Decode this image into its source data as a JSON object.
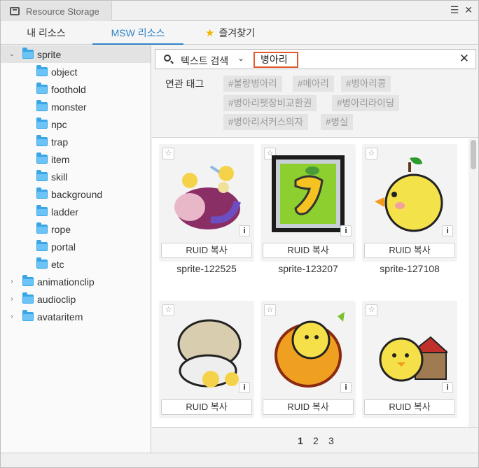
{
  "window": {
    "title": "Resource Storage",
    "menu_icon": "hamburger-icon",
    "close_icon": "close-icon"
  },
  "tabs": [
    {
      "label": "내 리소스"
    },
    {
      "label": "MSW 리소스"
    },
    {
      "label": "즐겨찾기"
    }
  ],
  "tree": {
    "root": "sprite",
    "children": [
      "object",
      "foothold",
      "monster",
      "npc",
      "trap",
      "item",
      "skill",
      "background",
      "ladder",
      "rope",
      "portal",
      "etc"
    ],
    "siblings": [
      "animationclip",
      "audioclip",
      "avataritem"
    ]
  },
  "search": {
    "type_label": "텍스트 검색",
    "query": "병아리"
  },
  "related_tags": {
    "title": "연관 태그",
    "tags": [
      "#불량병아리",
      "#메아리",
      "#병아리콩",
      "#병아리펫장비교환권",
      "#병아리라이딩",
      "#병아리서커스의자",
      "#병실"
    ]
  },
  "cards": [
    {
      "name": "sprite-122525",
      "ruid_label": "RUID 복사"
    },
    {
      "name": "sprite-123207",
      "ruid_label": "RUID 복사"
    },
    {
      "name": "sprite-127108",
      "ruid_label": "RUID 복사"
    },
    {
      "name": "",
      "ruid_label": "RUID 복사"
    },
    {
      "name": "",
      "ruid_label": "RUID 복사"
    },
    {
      "name": "",
      "ruid_label": "RUID 복사"
    }
  ],
  "pagination": {
    "pages": [
      "1",
      "2",
      "3"
    ],
    "current": "1"
  },
  "colors": {
    "accent": "#2f83c7",
    "search_highlight": "#e0592a",
    "folder": "#3aa6e6"
  }
}
